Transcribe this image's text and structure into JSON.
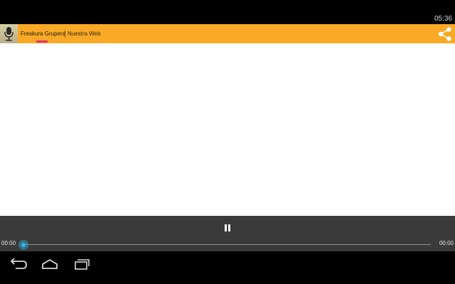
{
  "status_bar": {
    "time": "05:36"
  },
  "app_bar": {
    "tabs": [
      {
        "label": "Freskura Grupera",
        "active": true
      },
      {
        "label": "Nuestra Web",
        "active": false
      }
    ],
    "tab_separator": "|",
    "icons": {
      "app": "microphone-icon",
      "share": "share-icon"
    },
    "colors": {
      "bar": "#f9a925",
      "indicator": "#e8336a"
    }
  },
  "player": {
    "state": "playing",
    "control_icon": "pause-icon",
    "elapsed": "00:00",
    "total": "00:00",
    "progress": 0,
    "accent": "#33b5e5"
  },
  "nav_bar": {
    "icons": [
      "back-icon",
      "home-icon",
      "recent-apps-icon"
    ]
  }
}
